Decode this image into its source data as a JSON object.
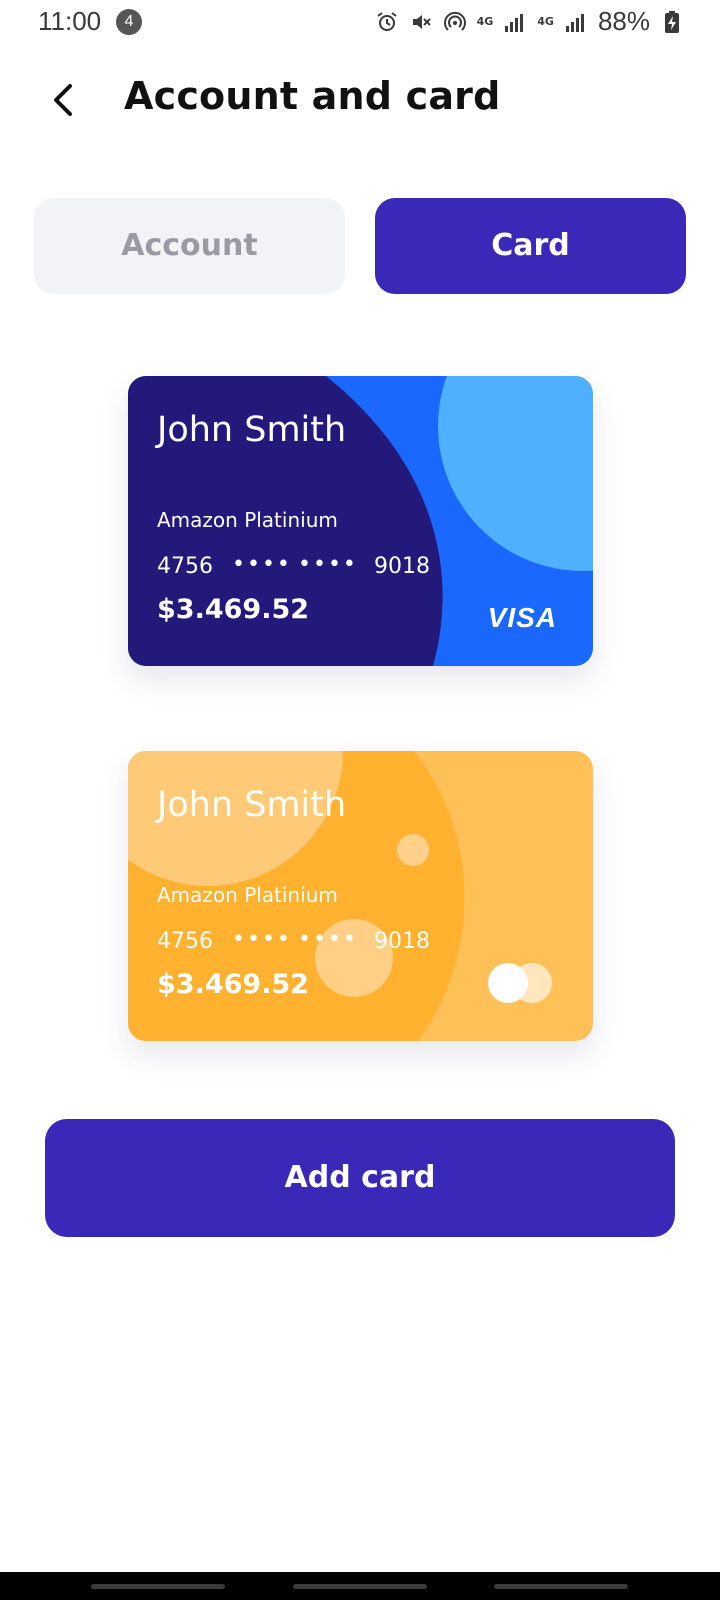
{
  "status_bar": {
    "time": "11:00",
    "notification_count": "4",
    "network_1": "4G",
    "network_2": "4G",
    "battery": "88%"
  },
  "header": {
    "back_icon": "chevron-left-icon",
    "title": "Account and card"
  },
  "tabs": [
    {
      "label": "Account",
      "active": false
    },
    {
      "label": "Card",
      "active": true
    }
  ],
  "cards": [
    {
      "holder": "John Smith",
      "type": "Amazon Platinium",
      "number_first": "4756",
      "dots_1": "••••",
      "dots_2": "••••",
      "number_last": "9018",
      "balance": "$3.469.52",
      "brand": "VISA",
      "colors": {
        "main": "#1b68ff",
        "dark": "#22197a",
        "accent": "#4fb0ff"
      }
    },
    {
      "holder": "John Smith",
      "type": "Amazon Platinium",
      "number_first": "4756",
      "dots_1": "••••",
      "dots_2": "••••",
      "number_last": "9018",
      "balance": "$3.469.52",
      "brand_icon": "mastercard-icon",
      "colors": {
        "main": "#ffc058",
        "mid": "#ffb12f",
        "light": "#ffd08a"
      }
    }
  ],
  "add_button": {
    "label": "Add card"
  },
  "colors": {
    "primary": "#3a28b8",
    "tab_inactive_bg": "#f2f3f7",
    "tab_inactive_text": "#9a9aa2"
  }
}
